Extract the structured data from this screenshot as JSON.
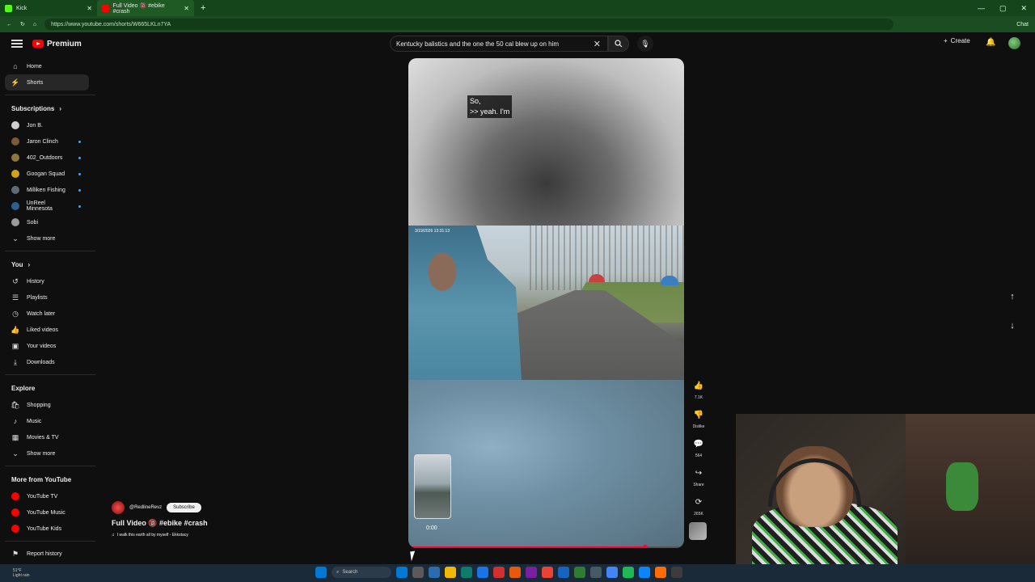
{
  "browser": {
    "tabs": [
      {
        "label": "Kick",
        "active": false,
        "color": "#53fc18"
      },
      {
        "label": "Full Video 🔞 #ebike #crash",
        "active": true,
        "color": "#ff0000"
      }
    ],
    "url": "https://www.youtube.com/shorts/W665LKLn7YA",
    "chat_label": "Chat"
  },
  "header": {
    "logo_text": "Premium",
    "search_value": "Kentucky balistics and the one the 50 cal blew up on him",
    "create_label": "Create"
  },
  "sidebar": {
    "main": [
      {
        "label": "Home",
        "icon": "home-icon",
        "glyph": "⌂"
      },
      {
        "label": "Shorts",
        "icon": "shorts-icon",
        "glyph": "⚡",
        "active": true
      }
    ],
    "subscriptions_title": "Subscriptions",
    "subscriptions": [
      {
        "label": "Jon B.",
        "color": "#cfcfcf",
        "dot": false
      },
      {
        "label": "Jaron Clinch",
        "color": "#7a5a3a",
        "dot": true
      },
      {
        "label": "402_Outdoors",
        "color": "#8a7a3a",
        "dot": true
      },
      {
        "label": "Googan Squad",
        "color": "#d4a017",
        "dot": true
      },
      {
        "label": "Milliken Fishing",
        "color": "#5b6b7a",
        "dot": true
      },
      {
        "label": "UnReel Minnesota",
        "color": "#2f5f8f",
        "dot": true
      },
      {
        "label": "Sobi",
        "color": "#9a9a9a",
        "dot": false
      }
    ],
    "show_more": "Show more",
    "you_title": "You",
    "you": [
      {
        "label": "History",
        "icon": "history-icon",
        "glyph": "↺"
      },
      {
        "label": "Playlists",
        "icon": "playlists-icon",
        "glyph": "☰"
      },
      {
        "label": "Watch later",
        "icon": "watch-later-icon",
        "glyph": "◷"
      },
      {
        "label": "Liked videos",
        "icon": "like-icon",
        "glyph": "👍"
      },
      {
        "label": "Your videos",
        "icon": "your-videos-icon",
        "glyph": "▣"
      },
      {
        "label": "Downloads",
        "icon": "download-icon",
        "glyph": "⤓"
      }
    ],
    "explore_title": "Explore",
    "explore": [
      {
        "label": "Shopping",
        "icon": "shopping-icon",
        "glyph": "🛍"
      },
      {
        "label": "Music",
        "icon": "music-icon",
        "glyph": "♪"
      },
      {
        "label": "Movies & TV",
        "icon": "movies-icon",
        "glyph": "▦"
      }
    ],
    "show_more_2": "Show more",
    "more_title": "More from YouTube",
    "more": [
      {
        "label": "YouTube TV",
        "color": "#ff0000"
      },
      {
        "label": "YouTube Music",
        "color": "#ff0000"
      },
      {
        "label": "YouTube Kids",
        "color": "#ff0000"
      }
    ],
    "report_label": "Report history"
  },
  "video": {
    "caption_line1": "So,",
    "caption_line2": ">> yeah. I'm",
    "timestamp": "3/19/2026  13:31:13",
    "thumb_time": "0:00",
    "progress": 0.86
  },
  "actions": [
    {
      "icon": "like-icon",
      "glyph": "👍",
      "label": "7.1K"
    },
    {
      "icon": "dislike-icon",
      "glyph": "👎",
      "label": "Dislike"
    },
    {
      "icon": "comment-icon",
      "glyph": "💬",
      "label": "564"
    },
    {
      "icon": "share-icon",
      "glyph": "↪",
      "label": "Share"
    },
    {
      "icon": "remix-icon",
      "glyph": "⟳",
      "label": "265K"
    }
  ],
  "channel": {
    "handle": "@RedlineRevz",
    "subscribe_label": "Subscribe",
    "title": "Full Video 🔞 #ebike #crash",
    "audio": "I walk this earth all by myself - Ekkstacy"
  },
  "taskbar": {
    "weather_temp": "51°F",
    "weather_desc": "Light rain",
    "search_placeholder": "Search",
    "app_colors": [
      "#0078d4",
      "#5a5a5a",
      "#2b6cb0",
      "#f3b700",
      "#0f7b6c",
      "#1a73e8",
      "#d32f2f",
      "#e8590c",
      "#7b1fa2",
      "#ea4335",
      "#1565c0",
      "#2e7d32",
      "#455a64",
      "#4285f4",
      "#1db954",
      "#0a84ff",
      "#ff6d00",
      "#3c3c3c"
    ]
  }
}
